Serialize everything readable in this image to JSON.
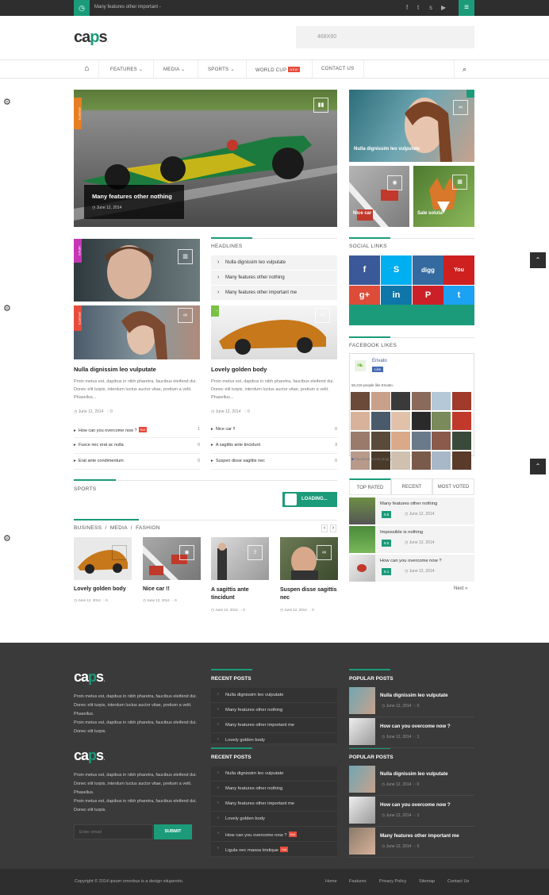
{
  "topbar": {
    "ticker": "Many features other important -"
  },
  "logo": {
    "text_dark": "ca",
    "text_green": "p",
    "text_tail": "s",
    "dot": "."
  },
  "ad": {
    "label": "468X60"
  },
  "nav": {
    "items": [
      "FEATURES",
      "MEDIA",
      "SPORTS",
      "WORLD CUP",
      "CONTACT US"
    ],
    "hot_label": "NEW"
  },
  "hero": {
    "ribbon": "SPORTS",
    "caption": "Many features other nothing",
    "date": "June 12, 2014"
  },
  "right_top": {
    "caption1": "Nulla dignissim leo vulputate",
    "caption2": "Nice car !!",
    "caption3": "Sale soluta"
  },
  "news": {
    "ribbon": "NEWS",
    "ribbon2": "SPORTS"
  },
  "headlines": {
    "title": "HEADLINES",
    "items": [
      "Nulla dignissim leo vulputate",
      "Many features other nothing",
      "Many features other important me"
    ]
  },
  "col1": {
    "title": "Nulla dignissim leo vulputate",
    "excerpt": "Proin metus est, dapibus in nibh pharetra, faucibus eleifend dui. Donec elit turpis, interdum luctus auctor vitae, pretium a velit. Phasellus...",
    "date": "June 12, 2014",
    "comments": "0",
    "list": [
      {
        "t": "How can you overcome now ?",
        "c": "1",
        "hot": true
      },
      {
        "t": "Fusce nec erat ac nulla",
        "c": "0"
      },
      {
        "t": "Erat ante condimentum",
        "c": "0"
      }
    ]
  },
  "col2": {
    "title": "Lovely golden body",
    "excerpt": "Proin metus est, dapibus in nibh pharetra, faucibus eleifend dui. Donec elit turpis, interdum luctus auctor vitae, pretium a velit. Phasellus...",
    "date": "June 12, 2014",
    "comments": "0",
    "list": [
      {
        "t": "Nice car !!",
        "c": "0"
      },
      {
        "t": "A sagittis ante tincidunt",
        "c": "3"
      },
      {
        "t": "Suspen disse sagittis nec",
        "c": "0"
      }
    ]
  },
  "social": {
    "title": "SOCIAL LINKS"
  },
  "facebook": {
    "title": "FACEBOOK LIKES",
    "page": "Envato",
    "like": "Like",
    "count": "56,216 people like Envato.",
    "plugin": "Facebook social plugin"
  },
  "sports": {
    "title": "SPORTS",
    "loading": "LOADING..."
  },
  "business": {
    "tabs": [
      "BUSINESS",
      "MEDIA",
      "FASHION"
    ],
    "cards": [
      {
        "title": "Lovely golden body",
        "date": "June 12, 2014",
        "c": "0"
      },
      {
        "title": "Nice car !!",
        "date": "June 12, 2014",
        "c": "0"
      },
      {
        "title": "A sagittis ante tincidunt",
        "date": "June 12, 2014",
        "c": "3"
      },
      {
        "title": "Suspen disse sagittis nec",
        "date": "June 12, 2014",
        "c": "0"
      }
    ]
  },
  "rated": {
    "tabs": [
      "TOP RATED",
      "RECENT",
      "MOST VOTED"
    ],
    "items": [
      {
        "title": "Many features other nothing",
        "score": "9.8",
        "date": "June 12, 2014"
      },
      {
        "title": "Impossible is nothing",
        "score": "9.5",
        "date": "June 12, 2014"
      },
      {
        "title": "How can you overcome now ?",
        "score": "9.1",
        "date": "June 12, 2014"
      }
    ],
    "next": "Next »"
  },
  "footer": {
    "about": "Proin metus est, dapibus in nibh pharetra, faucibus eleifend dui. Donec elit turpis, interdum luctus auctor vitae, pretium a velit. Phasellus.",
    "about2": "Proin metus est, dapibus in nibh pharetra, faucibus eleifend dui. Donec elit turpis.",
    "email_placeholder": "Enter email",
    "submit": "SUBMIT",
    "recent_title": "RECENT POSTS",
    "recent1": [
      "Nulla dignissim leo vulputate",
      "Many features other nothing",
      "Many features other important me",
      "Lovely golden body"
    ],
    "recent2": [
      "Nulla dignissim leo vulputate",
      "Many features other nothing",
      "Many features other important me",
      "Lovely golden body",
      "How can you overcome now ?",
      "Ligula nec massa tristique"
    ],
    "popular_title": "POPULAR POSTS",
    "popular1": [
      {
        "t": "Nulla dignissim leo vulputate",
        "d": "June 12, 2014",
        "c": "0"
      },
      {
        "t": "How can you overcome now ?",
        "d": "June 12, 2014",
        "c": "1"
      }
    ],
    "popular2": [
      {
        "t": "Nulla dignissim leo vulputate",
        "d": "June 12, 2014",
        "c": "0"
      },
      {
        "t": "How can you overcome now ?",
        "d": "June 12, 2014",
        "c": "1"
      },
      {
        "t": "Many features other important me",
        "d": "June 12, 2014",
        "c": "0"
      }
    ]
  },
  "bottom": {
    "copyright": "Copyright © 2014 ipsum ornorbus is a design vituperoto.",
    "links": [
      "Home",
      "Features",
      "Privacy Policy",
      "Sitemap",
      "Contact Us"
    ]
  },
  "colors": {
    "accent": "#1b9b7a",
    "dark": "#2e2e2e",
    "footer": "#3a3a3a"
  }
}
